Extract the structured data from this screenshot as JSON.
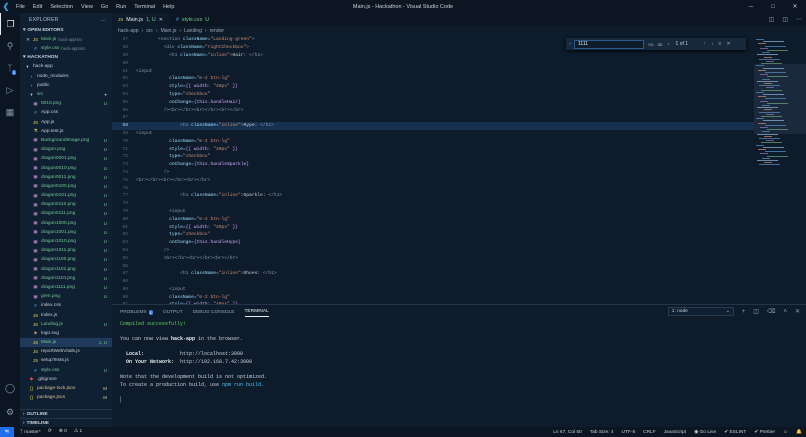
{
  "window": {
    "title": "Main.js - Hackathon - Visual Studio Code",
    "menu": [
      "File",
      "Edit",
      "Selection",
      "View",
      "Go",
      "Run",
      "Terminal",
      "Help"
    ],
    "controls": [
      "─",
      "□",
      "✕"
    ]
  },
  "activity": {
    "scm_badge": "1"
  },
  "explorer": {
    "header": "EXPLORER",
    "more": "…",
    "open_editors_label": "OPEN EDITORS",
    "open_editors": [
      {
        "name": "Main.js",
        "path": "hack-app\\src",
        "status": "1, U",
        "close": "✕"
      },
      {
        "name": "style.css",
        "path": "hack-app\\src",
        "status": "U"
      }
    ],
    "workspace_label": "HACKATHON",
    "tree": [
      {
        "name": "hack-app",
        "icon": "▾",
        "cls": "ic-fold",
        "indent": 1,
        "status": "",
        "sc": ""
      },
      {
        "name": "node_modules",
        "icon": "›",
        "cls": "ic-fold",
        "indent": 2,
        "status": "",
        "sc": ""
      },
      {
        "name": "public",
        "icon": "›",
        "cls": "ic-fold",
        "indent": 2,
        "status": "",
        "sc": ""
      },
      {
        "name": "src",
        "icon": "▾",
        "cls": "ic-fold",
        "indent": 2,
        "status": "●",
        "sc": "u"
      },
      {
        "name": "0010.png",
        "icon": "▣",
        "cls": "ic-img",
        "indent": 3,
        "status": "U",
        "sc": "u"
      },
      {
        "name": "App.css",
        "icon": "#",
        "cls": "ic-css",
        "indent": 3,
        "status": "",
        "sc": ""
      },
      {
        "name": "App.js",
        "icon": "JS",
        "cls": "ic-js",
        "indent": 3,
        "status": "",
        "sc": ""
      },
      {
        "name": "App.test.js",
        "icon": "⚗",
        "cls": "ic-js",
        "indent": 3,
        "status": "",
        "sc": ""
      },
      {
        "name": "BackgroundImage.png",
        "icon": "▣",
        "cls": "ic-img",
        "indent": 3,
        "status": "U",
        "sc": "u"
      },
      {
        "name": "dragon.png",
        "icon": "▣",
        "cls": "ic-img",
        "indent": 3,
        "status": "U",
        "sc": "u"
      },
      {
        "name": "dragon0001.png",
        "icon": "▣",
        "cls": "ic-img",
        "indent": 3,
        "status": "U",
        "sc": "u"
      },
      {
        "name": "dragon0010.png",
        "icon": "▣",
        "cls": "ic-img",
        "indent": 3,
        "status": "U",
        "sc": "u"
      },
      {
        "name": "dragon0011.png",
        "icon": "▣",
        "cls": "ic-img",
        "indent": 3,
        "status": "U",
        "sc": "u"
      },
      {
        "name": "dragon0100.png",
        "icon": "▣",
        "cls": "ic-img",
        "indent": 3,
        "status": "U",
        "sc": "u"
      },
      {
        "name": "dragon0101.png",
        "icon": "▣",
        "cls": "ic-img",
        "indent": 3,
        "status": "U",
        "sc": "u"
      },
      {
        "name": "dragon0110.png",
        "icon": "▣",
        "cls": "ic-img",
        "indent": 3,
        "status": "U",
        "sc": "u"
      },
      {
        "name": "dragon0111.png",
        "icon": "▣",
        "cls": "ic-img",
        "indent": 3,
        "status": "U",
        "sc": "u"
      },
      {
        "name": "dragon1000.png",
        "icon": "▣",
        "cls": "ic-img",
        "indent": 3,
        "status": "U",
        "sc": "u"
      },
      {
        "name": "dragon1001.png",
        "icon": "▣",
        "cls": "ic-img",
        "indent": 3,
        "status": "U",
        "sc": "u"
      },
      {
        "name": "dragon1010.png",
        "icon": "▣",
        "cls": "ic-img",
        "indent": 3,
        "status": "U",
        "sc": "u"
      },
      {
        "name": "dragon1011.png",
        "icon": "▣",
        "cls": "ic-img",
        "indent": 3,
        "status": "U",
        "sc": "u"
      },
      {
        "name": "dragon1100.png",
        "icon": "▣",
        "cls": "ic-img",
        "indent": 3,
        "status": "U",
        "sc": "u"
      },
      {
        "name": "dragon1101.png",
        "icon": "▣",
        "cls": "ic-img",
        "indent": 3,
        "status": "U",
        "sc": "u"
      },
      {
        "name": "dragon1110.png",
        "icon": "▣",
        "cls": "ic-img",
        "indent": 3,
        "status": "U",
        "sc": "u"
      },
      {
        "name": "dragon1111.png",
        "icon": "▣",
        "cls": "ic-img",
        "indent": 3,
        "status": "U",
        "sc": "u"
      },
      {
        "name": "gren.png",
        "icon": "▣",
        "cls": "ic-img",
        "indent": 3,
        "status": "U",
        "sc": "u"
      },
      {
        "name": "index.css",
        "icon": "#",
        "cls": "ic-css",
        "indent": 3,
        "status": "",
        "sc": ""
      },
      {
        "name": "index.js",
        "icon": "JS",
        "cls": "ic-js",
        "indent": 3,
        "status": "",
        "sc": ""
      },
      {
        "name": "Landing.js",
        "icon": "JS",
        "cls": "ic-js",
        "indent": 3,
        "status": "U",
        "sc": "u"
      },
      {
        "name": "logo.svg",
        "icon": "◈",
        "cls": "ic-svg",
        "indent": 3,
        "status": "",
        "sc": ""
      },
      {
        "name": "Main.js",
        "icon": "JS",
        "cls": "ic-js",
        "indent": 3,
        "status": "1, U",
        "sc": "u",
        "selected": true
      },
      {
        "name": "reportWebVitals.js",
        "icon": "JS",
        "cls": "ic-js",
        "indent": 3,
        "status": "",
        "sc": ""
      },
      {
        "name": "setupTests.js",
        "icon": "JS",
        "cls": "ic-js",
        "indent": 3,
        "status": "",
        "sc": ""
      },
      {
        "name": "style.css",
        "icon": "#",
        "cls": "ic-css",
        "indent": 3,
        "status": "U",
        "sc": "u"
      },
      {
        "name": ".gitignore",
        "icon": "◆",
        "cls": "ic-git",
        "indent": 2,
        "status": "",
        "sc": ""
      },
      {
        "name": "package-lock.json",
        "icon": "{}",
        "cls": "ic-json",
        "indent": 2,
        "status": "M",
        "sc": "m"
      },
      {
        "name": "package.json",
        "icon": "{}",
        "cls": "ic-json",
        "indent": 2,
        "status": "M",
        "sc": "m"
      }
    ],
    "outline_label": "OUTLINE",
    "timeline_label": "TIMELINE"
  },
  "tabs": [
    {
      "name": "Main.js",
      "status": "1, U",
      "active": true,
      "icon": "JS"
    },
    {
      "name": "style.css",
      "status": "U",
      "active": false,
      "icon": "#"
    }
  ],
  "breadcrumb": [
    "hack-app",
    "src",
    "Main.js",
    "Landing",
    "render"
  ],
  "find": {
    "query": "1111",
    "count": "1 of 1",
    "opts": [
      "Aa",
      "ab",
      ".*"
    ]
  },
  "code": [
    {
      "n": "57",
      "t": [
        [
          "        <",
          "tag"
        ],
        [
          "section",
          "tag"
        ],
        [
          " className=",
          "attr"
        ],
        [
          "\"Landing-green\"",
          "str"
        ],
        [
          ">",
          "tag"
        ]
      ]
    },
    {
      "n": "58",
      "t": [
        [
          "          <",
          "tag"
        ],
        [
          "div",
          "tag"
        ],
        [
          " className=",
          "attr"
        ],
        [
          "\"rightCheckbox\"",
          "str"
        ],
        [
          ">",
          "tag"
        ]
      ]
    },
    {
      "n": "59",
      "t": [
        [
          "            <",
          "tag"
        ],
        [
          "h1",
          "tag"
        ],
        [
          " className=",
          "attr"
        ],
        [
          "\"inline\"",
          "str"
        ],
        [
          ">",
          "tag"
        ],
        [
          "Hair: ",
          "txt"
        ],
        [
          "</h1>",
          "tag"
        ]
      ]
    },
    {
      "n": "60",
      "t": []
    },
    {
      "n": "61",
      "t": [
        [
          "<input",
          "tag"
        ]
      ]
    },
    {
      "n": "62",
      "t": [
        [
          "            className=",
          "attr"
        ],
        [
          "\"m-2 btn-lg\"",
          "str"
        ]
      ]
    },
    {
      "n": "63",
      "t": [
        [
          "            style=",
          "attr"
        ],
        [
          "{{ width: ",
          "brace"
        ],
        [
          "\"40px\"",
          "str"
        ],
        [
          " }}",
          "brace"
        ]
      ]
    },
    {
      "n": "64",
      "t": [
        [
          "            type=",
          "attr"
        ],
        [
          "\"checkbox\"",
          "str"
        ]
      ]
    },
    {
      "n": "65",
      "t": [
        [
          "            onChange=",
          "attr"
        ],
        [
          "{this.handleHair}",
          "brace"
        ]
      ]
    },
    {
      "n": "66",
      "t": [
        [
          "          />",
          "tag"
        ],
        [
          "<br></br><br></br><br></br>",
          "tag"
        ]
      ]
    },
    {
      "n": "67",
      "t": []
    },
    {
      "n": "68",
      "cur": true,
      "t": [
        [
          "                <",
          "tag"
        ],
        [
          "h1",
          "tag"
        ],
        [
          " className=",
          "attr"
        ],
        [
          "\"inline\"",
          "str"
        ],
        [
          ">",
          "tag"
        ],
        [
          "Hype: ",
          "txt"
        ],
        [
          "</h1>",
          "tag"
        ]
      ]
    },
    {
      "n": "69",
      "t": [
        [
          "<input",
          "tag"
        ]
      ]
    },
    {
      "n": "70",
      "t": [
        [
          "            className=",
          "attr"
        ],
        [
          "\"m-2 btn-lg\"",
          "str"
        ]
      ]
    },
    {
      "n": "71",
      "t": [
        [
          "            style=",
          "attr"
        ],
        [
          "{{ width: ",
          "brace"
        ],
        [
          "\"40px\"",
          "str"
        ],
        [
          " }}",
          "brace"
        ]
      ]
    },
    {
      "n": "72",
      "t": [
        [
          "            type=",
          "attr"
        ],
        [
          "\"checkbox\"",
          "str"
        ]
      ]
    },
    {
      "n": "73",
      "t": [
        [
          "            onChange=",
          "attr"
        ],
        [
          "{this.handleSparkle}",
          "brace"
        ]
      ]
    },
    {
      "n": "74",
      "t": [
        [
          "          />",
          "tag"
        ]
      ]
    },
    {
      "n": "75",
      "t": [
        [
          "<br></br><br></br><br></br>",
          "tag"
        ]
      ]
    },
    {
      "n": "76",
      "t": []
    },
    {
      "n": "77",
      "t": [
        [
          "                <",
          "tag"
        ],
        [
          "h1",
          "tag"
        ],
        [
          " className=",
          "attr"
        ],
        [
          "\"inline\"",
          "str"
        ],
        [
          ">",
          "tag"
        ],
        [
          "Sparkle: ",
          "txt"
        ],
        [
          "</h1>",
          "tag"
        ]
      ]
    },
    {
      "n": "78",
      "t": []
    },
    {
      "n": "79",
      "t": [
        [
          "            <input",
          "tag"
        ]
      ]
    },
    {
      "n": "80",
      "t": [
        [
          "            className=",
          "attr"
        ],
        [
          "\"m-2 btn-lg\"",
          "str"
        ]
      ]
    },
    {
      "n": "81",
      "t": [
        [
          "            style=",
          "attr"
        ],
        [
          "{{ width: ",
          "brace"
        ],
        [
          "\"40px\"",
          "str"
        ],
        [
          " }}",
          "brace"
        ]
      ]
    },
    {
      "n": "82",
      "t": [
        [
          "            type=",
          "attr"
        ],
        [
          "\"checkbox\"",
          "str"
        ]
      ]
    },
    {
      "n": "83",
      "t": [
        [
          "            onChange=",
          "attr"
        ],
        [
          "{this.handleHype}",
          "brace"
        ]
      ]
    },
    {
      "n": "84",
      "t": [
        [
          "          />",
          "tag"
        ]
      ]
    },
    {
      "n": "85",
      "t": [
        [
          "          <br></br><br></br><br></br>",
          "tag"
        ]
      ]
    },
    {
      "n": "86",
      "t": []
    },
    {
      "n": "87",
      "t": [
        [
          "                <",
          "tag"
        ],
        [
          "h1",
          "tag"
        ],
        [
          " className=",
          "attr"
        ],
        [
          "\"inline\"",
          "str"
        ],
        [
          ">",
          "tag"
        ],
        [
          "Shoes: ",
          "txt"
        ],
        [
          "</h1>",
          "tag"
        ]
      ]
    },
    {
      "n": "88",
      "t": []
    },
    {
      "n": "89",
      "t": [
        [
          "            <input",
          "tag"
        ]
      ]
    },
    {
      "n": "90",
      "t": [
        [
          "            className=",
          "attr"
        ],
        [
          "\"m-2 btn-lg\"",
          "str"
        ]
      ]
    },
    {
      "n": "91",
      "t": [
        [
          "            style=",
          "attr"
        ],
        [
          "{{ width: ",
          "brace"
        ],
        [
          "\"40px\"",
          "str"
        ],
        [
          " }}",
          "brace"
        ]
      ]
    }
  ],
  "panel": {
    "tabs": [
      {
        "label": "PROBLEMS",
        "badge": "1"
      },
      {
        "label": "OUTPUT"
      },
      {
        "label": "DEBUG CONSOLE"
      },
      {
        "label": "TERMINAL",
        "active": true
      }
    ],
    "terminal_select": "1: node",
    "icons": [
      "+",
      "◫",
      "🗑",
      "˄",
      "✕"
    ]
  },
  "terminal": {
    "compiled": "Compiled successfully!",
    "view_pre": "You can now view ",
    "app": "hack-app",
    "view_post": " in the browser.",
    "local_label": "  Local:",
    "local_url": "http://localhost:3000",
    "network_label": "  On Your Network:",
    "network_url": "http://192.168.7.42:3000",
    "note1": "Note that the development build is not optimized.",
    "note2_pre": "To create a production build, use ",
    "note2_cmd": "npm run build",
    "note2_post": ".",
    "cursor": "▏"
  },
  "status": {
    "branch": "master*",
    "sync": "⟳",
    "errors": "⊗ 0",
    "warnings": "⚠ 1",
    "right": [
      "Ln 67, Col 50",
      "Tab Size: 4",
      "UTF-8",
      "CRLF",
      "JavaScript",
      "◉ Go Live",
      "✔ ESLINT",
      "✔ Prettier",
      "☺",
      "🔔"
    ]
  }
}
